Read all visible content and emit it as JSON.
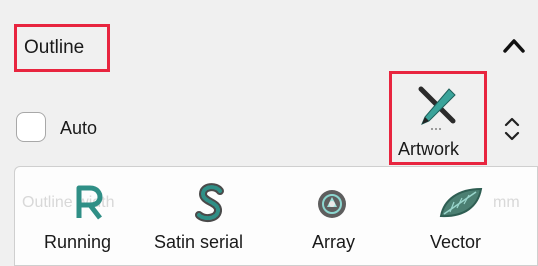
{
  "outline": {
    "title": "Outline",
    "collapse_icon": "chevron-up-icon",
    "auto_checkbox": {
      "label": "Auto",
      "checked": false
    },
    "artwork_button": {
      "label": "Artwork",
      "icon": "pen-icon"
    },
    "spin_icon": "up-down-chevron-icon",
    "hidden_field": {
      "label": "Outline width",
      "unit": "mm"
    },
    "types": [
      {
        "label": "Running",
        "icon": "running-r-icon"
      },
      {
        "label": "Satin serial",
        "icon": "satin-s-icon"
      },
      {
        "label": "Array",
        "icon": "array-ball-icon"
      },
      {
        "label": "Vector",
        "icon": "vector-leaf-icon"
      }
    ]
  }
}
